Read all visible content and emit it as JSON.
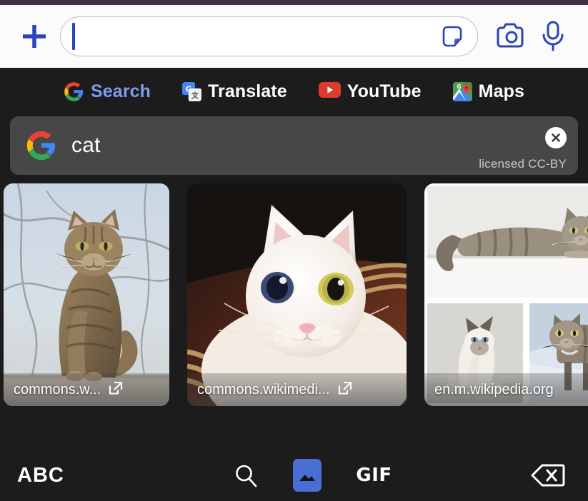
{
  "theme": {
    "status_strip_color": "#402e42",
    "compose_bg": "#fbfbfb",
    "keyboard_bg": "#1c1c1c",
    "chip_bg": "#474747",
    "accent_blue": "#2b44b8",
    "link_blue": "#7d9cf0",
    "image_tab_blue": "#4a6fd4"
  },
  "compose": {
    "add_icon": "plus-icon",
    "input_value": "",
    "input_placeholder": "",
    "sticker_icon": "sticker-icon",
    "camera_icon": "camera-icon",
    "mic_icon": "microphone-icon"
  },
  "categories": [
    {
      "label": "Search",
      "icon": "google-g-icon",
      "accent": true
    },
    {
      "label": "Translate",
      "icon": "google-translate-icon",
      "accent": false
    },
    {
      "label": "YouTube",
      "icon": "youtube-icon",
      "accent": false
    },
    {
      "label": "Maps",
      "icon": "google-maps-icon",
      "accent": false
    }
  ],
  "query_chip": {
    "icon": "google-g-icon",
    "query": "cat",
    "clear_icon": "close-icon",
    "license": "licensed CC-BY"
  },
  "results": [
    {
      "host": "commons.w...",
      "open_icon": "open-in-new-icon",
      "alt": "Brown tabby cat sitting on a stone wall against a pale sky with bare branches"
    },
    {
      "host": "commons.wikimedi...",
      "open_icon": "open-in-new-icon",
      "alt": "Close-up of a white cat with odd eyes, one blue and one yellow-green, in a wicker basket"
    },
    {
      "host": "en.m.wikipedia.org",
      "open_icon": "",
      "alt": "Collage of three cats: a tabby lying on a white ledge, a seated siamese kitten, and a tabby standing in snow"
    }
  ],
  "bottom_bar": {
    "abc_label": "ABC",
    "search_icon": "search-icon",
    "image_icon": "image-icon",
    "gif_label": "GIF",
    "backspace_icon": "backspace-icon"
  }
}
